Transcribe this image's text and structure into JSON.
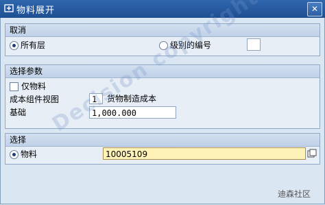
{
  "window": {
    "title": "物料展开",
    "close_label": "✕"
  },
  "group_cancel": {
    "header": "取消",
    "opt_all": "所有层",
    "opt_level": "级别的编号",
    "level_value": ""
  },
  "group_params": {
    "header": "选择参数",
    "only_material": "仅物料",
    "cost_view_label": "成本组件视图",
    "cost_view_value": "1",
    "cost_view_desc": "货物制造成本",
    "base_label": "基础",
    "base_value": "1,000.000"
  },
  "group_select": {
    "header": "选择",
    "opt_material": "物料",
    "material_value": "10005109"
  },
  "watermark": "Decision copyright",
  "brand": "迪森社区",
  "colors": {
    "titlebar": "#1f4f93",
    "group_header": "#c9d8ec",
    "active_field": "#fff3b8"
  }
}
